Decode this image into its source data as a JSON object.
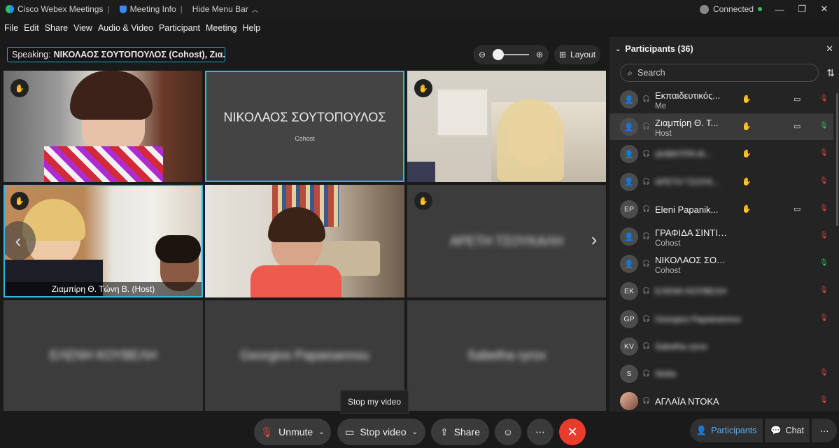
{
  "titlebar": {
    "app_name": "Cisco Webex Meetings",
    "meeting_info": "Meeting Info",
    "hide_menu": "Hide Menu Bar",
    "connection": "Connected"
  },
  "menu": [
    "File",
    "Edit",
    "Share",
    "View",
    "Audio & Video",
    "Participant",
    "Meeting",
    "Help"
  ],
  "speaking": {
    "label": "Speaking:",
    "value": "ΝΙΚΟΛΑΟΣ ΣΟΥΤΟΠΟΥΛΟΣ (Cohost), Ζια..."
  },
  "layout_label": "Layout",
  "tiles": {
    "t2_name": "ΝΙΚΟΛΑΟΣ ΣΟΥΤΟΠΟΥΛΟΣ",
    "t2_role": "Cohost",
    "t4_label": "Ζιαμπίρη Θ. Τώνη Β. (Host)",
    "t6_blur": "ΑΡΕΤΗ ΤΣΟΥΚΑΛΗ",
    "t7_blur": "ΕΛΕΝΗ ΚΟΥΒΕΛΗ",
    "t8_blur": "Georgios Papaioannou",
    "t9_blur": "Sabetha ryrox"
  },
  "tooltip": "Stop my video",
  "controls": {
    "unmute": "Unmute",
    "stop_video": "Stop video",
    "share": "Share"
  },
  "panel": {
    "title": "Participants (36)",
    "search_placeholder": "Search",
    "participants": [
      {
        "name": "Εκπαιδευτικός...",
        "role": "Me",
        "initials": "",
        "mic": "muted",
        "video": true,
        "hand": true
      },
      {
        "name": "Ζιαμπίρη Θ. Τ...",
        "role": "Host",
        "initials": "",
        "mic": "on",
        "video": true,
        "hand": true
      },
      {
        "name": "ΔΗΜΗΤΡΑ Μ...",
        "role": "",
        "initials": "",
        "mic": "muted",
        "video": false,
        "hand": true,
        "blur": true
      },
      {
        "name": "ΑΡΕΤΗ ΤΣΟΥΚ...",
        "role": "",
        "initials": "",
        "mic": "muted",
        "video": false,
        "hand": true,
        "blur": true
      },
      {
        "name": "Eleni Papanik...",
        "role": "",
        "initials": "EP",
        "mic": "muted",
        "video": true,
        "hand": true
      },
      {
        "name": "ΓΡΑΦΙΔΑ ΣΙΝΤΙΚΗΣ",
        "role": "Cohost",
        "initials": "",
        "mic": "muted",
        "video": false,
        "hand": false
      },
      {
        "name": "ΝΙΚΟΛΑΟΣ ΣΟΥΤΟΠΟΥΛΟΣ",
        "role": "Cohost",
        "initials": "",
        "mic": "on",
        "video": false,
        "hand": false
      },
      {
        "name": "ΕΛΕΝΗ ΚΟΥΒΕΛΗ",
        "role": "",
        "initials": "EK",
        "mic": "muted",
        "video": false,
        "hand": false,
        "blur": true
      },
      {
        "name": "Georgios Papaioannou",
        "role": "",
        "initials": "GP",
        "mic": "muted",
        "video": false,
        "hand": false,
        "blur": true
      },
      {
        "name": "Sabetha ryrox",
        "role": "",
        "initials": "KV",
        "mic": "",
        "video": false,
        "hand": false,
        "blur": true
      },
      {
        "name": "Stella",
        "role": "",
        "initials": "S",
        "mic": "muted",
        "video": false,
        "hand": false,
        "blur": true
      },
      {
        "name": "ΑΓΛΑΪΑ ΝΤΟΚΑ",
        "role": "",
        "initials": "",
        "mic": "muted",
        "video": false,
        "hand": false,
        "photo": true
      }
    ]
  },
  "bottom_panel": {
    "participants": "Participants",
    "chat": "Chat"
  }
}
